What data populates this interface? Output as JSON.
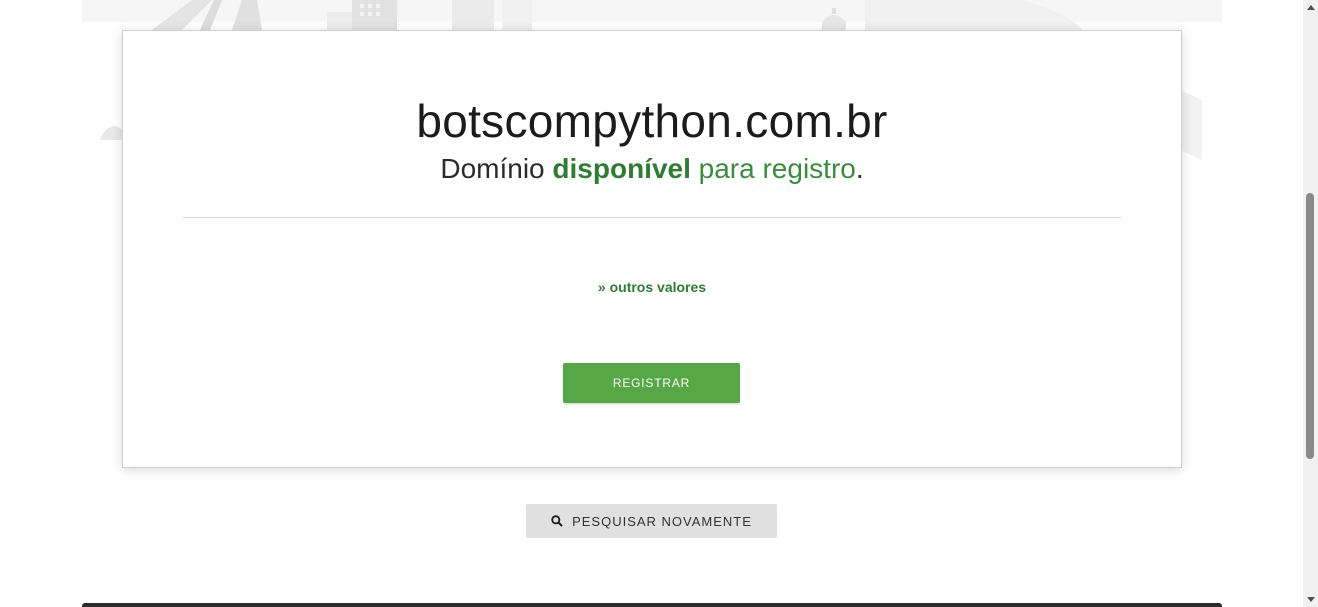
{
  "result": {
    "domain": "botscompython.com.br",
    "status_prefix": "Domínio",
    "status_word": "disponível",
    "status_suffix": "para registro",
    "status_period": "."
  },
  "links": {
    "other_prices": "» outros valores"
  },
  "buttons": {
    "register": "REGISTRAR",
    "search_again": "PESQUISAR NOVAMENTE"
  },
  "icons": {
    "search_again_icon": "search-icon"
  },
  "colors": {
    "available_green": "#2e7d32",
    "register_button": "#56a846",
    "secondary_button": "#e0e0e0"
  }
}
